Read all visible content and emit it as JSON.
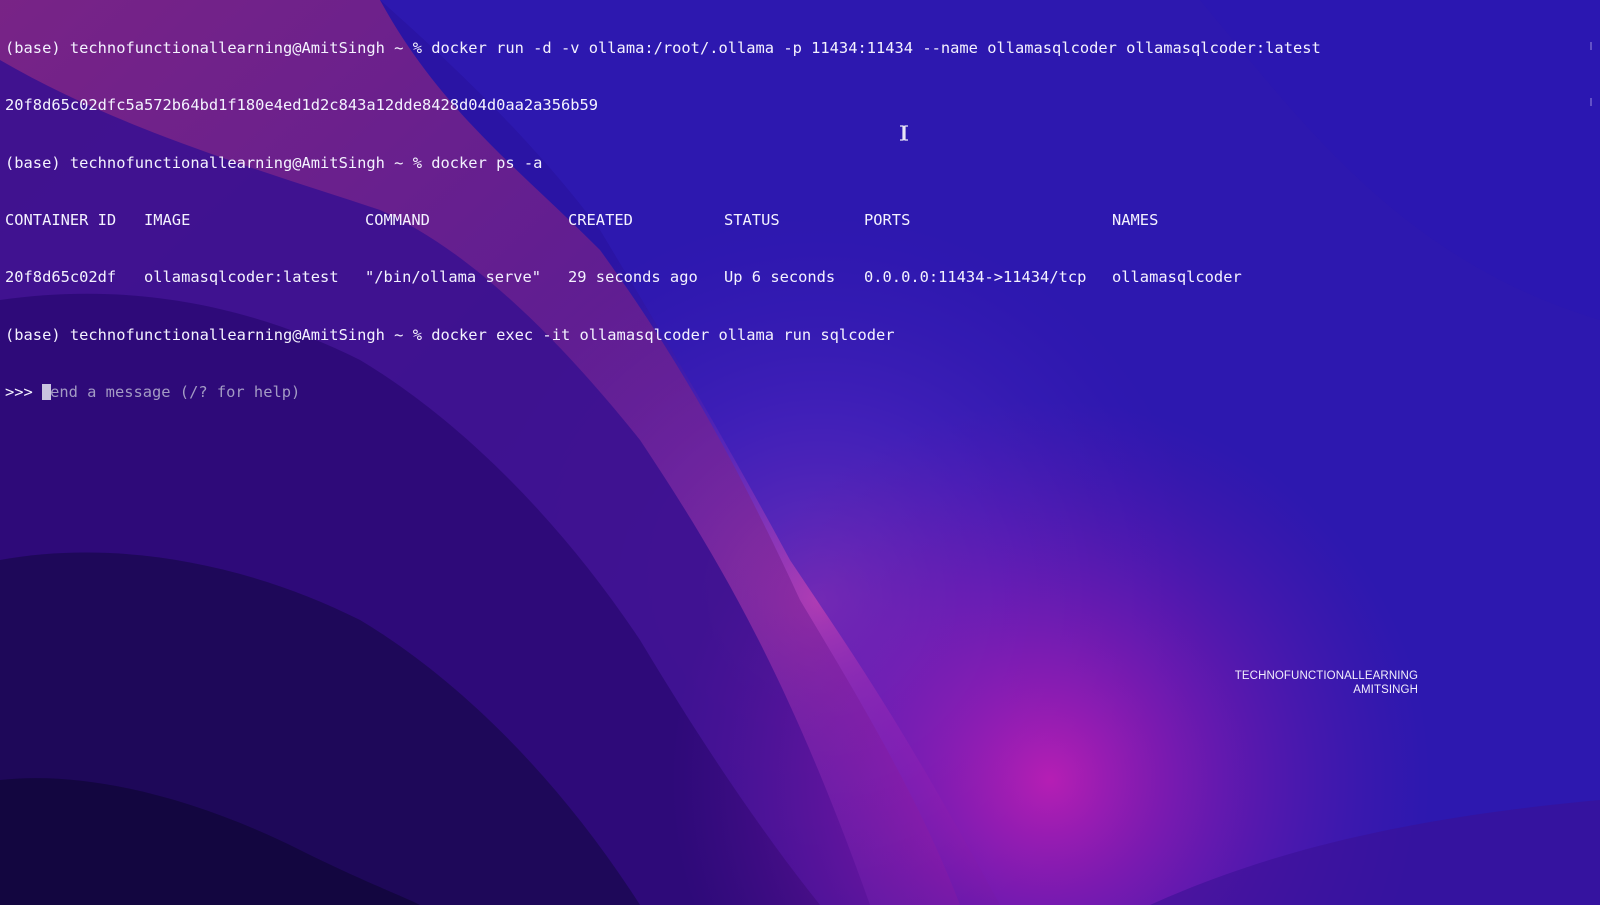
{
  "terminal": {
    "lines": {
      "cmd1": "(base) technofunctionallearning@AmitSingh ~ % docker run -d -v ollama:/root/.ollama -p 11434:11434 --name ollamasqlcoder ollamasqlcoder:latest",
      "hash": "20f8d65c02dfc5a572b64bd1f180e4ed1d2c843a12dde8428d04d0aa2a356b59",
      "cmd2": "(base) technofunctionallearning@AmitSingh ~ % docker ps -a",
      "cmd3": "(base) technofunctionallearning@AmitSingh ~ % docker exec -it ollamasqlcoder ollama run sqlcoder"
    },
    "ps_table": {
      "headers": [
        "CONTAINER ID",
        "IMAGE",
        "COMMAND",
        "CREATED",
        "STATUS",
        "PORTS",
        "NAMES"
      ],
      "row": [
        "20f8d65c02df",
        "ollamasqlcoder:latest",
        "\"/bin/ollama serve\"",
        "29 seconds ago",
        "Up 6 seconds",
        "0.0.0.0:11434->11434/tcp",
        "ollamasqlcoder"
      ]
    },
    "input": {
      "prompt": ">>> ",
      "placeholder": "end a message (/? for help)"
    }
  },
  "watermark": {
    "line1": "TECHNOFUNCTIONALLEARNING",
    "line2": "AMITSINGH"
  },
  "colors": {
    "text": "#f4f2ff",
    "placeholder": "#a39bc4",
    "background_base": "#2a13a0",
    "wave_magenta": "#c02ab8",
    "wave_deep": "#1a0a55"
  }
}
